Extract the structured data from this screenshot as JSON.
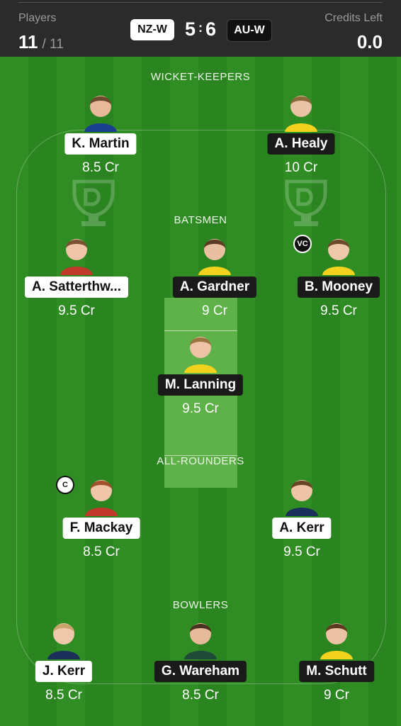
{
  "header": {
    "players_label": "Players",
    "players_selected": "11",
    "players_total": "/ 11",
    "credits_label": "Credits Left",
    "credits_value": "0.0",
    "team_left": "NZ-W",
    "team_right": "AU-W",
    "team_left_count": "5",
    "team_right_count": "6",
    "separator": ":"
  },
  "colors": {
    "field_green": "#2f8d23",
    "pitch": "#5fb14a",
    "nz_tag": "#ffffff",
    "au_tag": "#1a1a1a",
    "header_bg": "#2b2b2b"
  },
  "sections": {
    "wicket_keepers": "WICKET-KEEPERS",
    "batsmen": "BATSMEN",
    "all_rounders": "ALL-ROUNDERS",
    "bowlers": "BOWLERS"
  },
  "players": [
    {
      "name": "K. Martin",
      "credits": "8.5 Cr",
      "team": "nz"
    },
    {
      "name": "A. Healy",
      "credits": "10 Cr",
      "team": "au"
    },
    {
      "name": "A. Satterthw...",
      "credits": "9.5 Cr",
      "team": "nz"
    },
    {
      "name": "A. Gardner",
      "credits": "9 Cr",
      "team": "au"
    },
    {
      "name": "B. Mooney",
      "credits": "9.5 Cr",
      "team": "au",
      "badge": "VC"
    },
    {
      "name": "M. Lanning",
      "credits": "9.5 Cr",
      "team": "au"
    },
    {
      "name": "F. Mackay",
      "credits": "8.5 Cr",
      "team": "nz",
      "badge": "C"
    },
    {
      "name": "A. Kerr",
      "credits": "9.5 Cr",
      "team": "nz"
    },
    {
      "name": "J. Kerr",
      "credits": "8.5 Cr",
      "team": "nz"
    },
    {
      "name": "G. Wareham",
      "credits": "8.5 Cr",
      "team": "au"
    },
    {
      "name": "M. Schutt",
      "credits": "9 Cr",
      "team": "au"
    }
  ],
  "icons": {
    "avatar": "player-avatar-icon",
    "watermark": "trophy-watermark-icon"
  }
}
